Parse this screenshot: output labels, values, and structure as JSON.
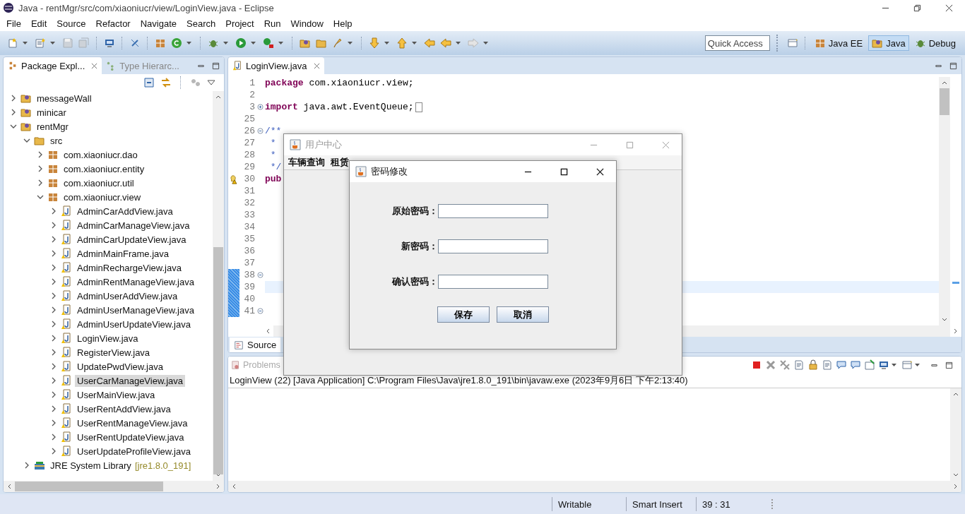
{
  "window": {
    "title": "Java - rentMgr/src/com/xiaoniucr/view/LoginView.java - Eclipse"
  },
  "menu": [
    "File",
    "Edit",
    "Source",
    "Refactor",
    "Navigate",
    "Search",
    "Project",
    "Run",
    "Window",
    "Help"
  ],
  "quick_access": {
    "placeholder": "Quick Access"
  },
  "perspectives": [
    {
      "label": "Java EE",
      "kind": "javaee",
      "selected": false
    },
    {
      "label": "Java",
      "kind": "java",
      "selected": true
    },
    {
      "label": "Debug",
      "kind": "debug",
      "selected": false
    }
  ],
  "explorer": {
    "tabs": [
      {
        "label": "Package Expl...",
        "selected": true,
        "closable": true
      },
      {
        "label": "Type Hierarc...",
        "selected": false,
        "closable": false
      }
    ],
    "tree": [
      {
        "label": "messageWall",
        "kind": "project",
        "expanded": false,
        "selected": false
      },
      {
        "label": "minicar",
        "kind": "project",
        "expanded": false,
        "selected": false
      },
      {
        "label": "rentMgr",
        "kind": "project",
        "expanded": true,
        "selected": false,
        "children": [
          {
            "label": "src",
            "kind": "srcfolder",
            "expanded": true,
            "selected": false,
            "children": [
              {
                "label": "com.xiaoniucr.dao",
                "kind": "package",
                "expanded": false,
                "selected": false
              },
              {
                "label": "com.xiaoniucr.entity",
                "kind": "package",
                "expanded": false,
                "selected": false
              },
              {
                "label": "com.xiaoniucr.util",
                "kind": "package",
                "expanded": false,
                "selected": false
              },
              {
                "label": "com.xiaoniucr.view",
                "kind": "package",
                "expanded": true,
                "selected": false,
                "children": [
                  {
                    "label": "AdminCarAddView.java",
                    "kind": "file",
                    "expanded": false,
                    "selected": false
                  },
                  {
                    "label": "AdminCarManageView.java",
                    "kind": "file",
                    "expanded": false,
                    "selected": false
                  },
                  {
                    "label": "AdminCarUpdateView.java",
                    "kind": "file",
                    "expanded": false,
                    "selected": false
                  },
                  {
                    "label": "AdminMainFrame.java",
                    "kind": "file",
                    "expanded": false,
                    "selected": false
                  },
                  {
                    "label": "AdminRechargeView.java",
                    "kind": "file",
                    "expanded": false,
                    "selected": false
                  },
                  {
                    "label": "AdminRentManageView.java",
                    "kind": "file",
                    "expanded": false,
                    "selected": false
                  },
                  {
                    "label": "AdminUserAddView.java",
                    "kind": "file",
                    "expanded": false,
                    "selected": false
                  },
                  {
                    "label": "AdminUserManageView.java",
                    "kind": "file",
                    "expanded": false,
                    "selected": false
                  },
                  {
                    "label": "AdminUserUpdateView.java",
                    "kind": "file",
                    "expanded": false,
                    "selected": false
                  },
                  {
                    "label": "LoginView.java",
                    "kind": "file",
                    "expanded": false,
                    "selected": false
                  },
                  {
                    "label": "RegisterView.java",
                    "kind": "file",
                    "expanded": false,
                    "selected": false
                  },
                  {
                    "label": "UpdatePwdView.java",
                    "kind": "file",
                    "expanded": false,
                    "selected": false
                  },
                  {
                    "label": "UserCarManageView.java",
                    "kind": "file",
                    "expanded": false,
                    "selected": true
                  },
                  {
                    "label": "UserMainView.java",
                    "kind": "file",
                    "expanded": false,
                    "selected": false
                  },
                  {
                    "label": "UserRentAddView.java",
                    "kind": "file",
                    "expanded": false,
                    "selected": false
                  },
                  {
                    "label": "UserRentManageView.java",
                    "kind": "file",
                    "expanded": false,
                    "selected": false
                  },
                  {
                    "label": "UserRentUpdateView.java",
                    "kind": "file",
                    "expanded": false,
                    "selected": false
                  },
                  {
                    "label": "UserUpdateProfileView.java",
                    "kind": "file",
                    "expanded": false,
                    "selected": false
                  }
                ]
              }
            ]
          },
          {
            "label": "JRE System Library",
            "decoration": "[jre1.8.0_191]",
            "kind": "library",
            "expanded": false,
            "selected": false
          }
        ]
      }
    ]
  },
  "editor": {
    "tabs": [
      {
        "label": "LoginView.java",
        "selected": true,
        "closable": true
      }
    ],
    "lines": [
      {
        "number": "1",
        "tokens": [
          {
            "kind": "keyword",
            "text": "package"
          },
          {
            "kind": "plain",
            "text": " com.xiaoniucr.view;"
          }
        ],
        "warning": false,
        "current": false,
        "changed": false
      },
      {
        "number": "2",
        "warning": false,
        "current": false,
        "changed": false
      },
      {
        "number": "3",
        "fold": {
          "collapsed": true
        },
        "tokens": [
          {
            "kind": "keyword",
            "text": "import"
          },
          {
            "kind": "plain",
            "text": " java.awt.EventQueue;"
          }
        ],
        "warning": false,
        "current": false,
        "changed": false
      },
      {
        "number": "25",
        "warning": false,
        "current": false,
        "changed": false
      },
      {
        "number": "26",
        "fold": {
          "collapsed": false
        },
        "tokens": [
          {
            "kind": "comment",
            "text": "/**"
          }
        ],
        "warning": false,
        "current": false,
        "changed": false
      },
      {
        "number": "27",
        "tokens": [
          {
            "kind": "comment",
            "text": " *"
          }
        ],
        "warning": false,
        "current": false,
        "changed": false
      },
      {
        "number": "28",
        "tokens": [
          {
            "kind": "comment",
            "text": " *"
          }
        ],
        "warning": false,
        "current": false,
        "changed": false
      },
      {
        "number": "29",
        "tokens": [
          {
            "kind": "comment",
            "text": " */"
          }
        ],
        "warning": false,
        "current": false,
        "changed": false
      },
      {
        "number": "30",
        "tokens": [
          {
            "kind": "keyword",
            "text": "pub"
          }
        ],
        "warning": true,
        "current": false,
        "changed": false
      },
      {
        "number": "31",
        "warning": false,
        "current": false,
        "changed": false
      },
      {
        "number": "32",
        "warning": false,
        "current": false,
        "changed": false
      },
      {
        "number": "33",
        "warning": false,
        "current": false,
        "changed": false
      },
      {
        "number": "34",
        "warning": false,
        "current": false,
        "changed": false
      },
      {
        "number": "35",
        "warning": false,
        "current": false,
        "changed": false
      },
      {
        "number": "36",
        "warning": false,
        "current": false,
        "changed": false
      },
      {
        "number": "37",
        "warning": false,
        "current": false,
        "changed": false
      },
      {
        "number": "38",
        "fold": {
          "collapsed": false
        },
        "warning": false,
        "current": false,
        "changed": true
      },
      {
        "number": "39",
        "warning": false,
        "current": true,
        "changed": true
      },
      {
        "number": "40",
        "warning": false,
        "current": false,
        "changed": true
      },
      {
        "number": "41",
        "fold": {
          "collapsed": false
        },
        "warning": false,
        "current": false,
        "changed": true
      }
    ],
    "bottom_tabs": [
      {
        "label": "Source",
        "selected": true
      }
    ]
  },
  "console": {
    "tabs": [
      {
        "label": "Problems",
        "selected": false
      }
    ],
    "lines": [
      "LoginView (22) [Java Application] C:\\Program Files\\Java\\jre1.8.0_191\\bin\\javaw.exe (2023年9月6日 下午2:13:40)"
    ]
  },
  "user_center_window": {
    "title": "用户中心",
    "active": false,
    "menu": [
      "车辆查询",
      "租赁"
    ]
  },
  "password_dialog": {
    "title": "密码修改",
    "active": true,
    "fields": [
      {
        "label": "原始密码："
      },
      {
        "label": "新密码："
      },
      {
        "label": "确认密码："
      }
    ],
    "buttons": [
      "保存",
      "取消"
    ]
  },
  "status_bar": [
    "Writable",
    "Smart Insert",
    "39 : 31"
  ]
}
